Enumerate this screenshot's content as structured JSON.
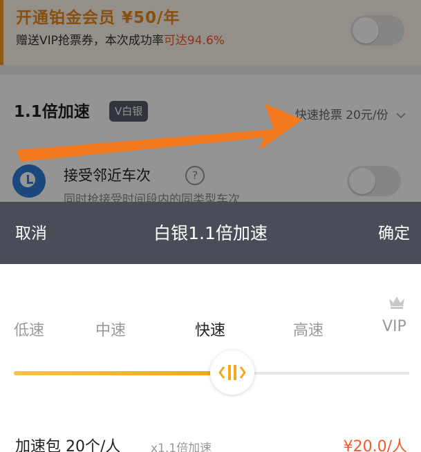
{
  "background": {
    "vip": {
      "title": "开通铂金会员 ¥50/年",
      "subtitle_prefix": "赠送VIP抢票券，本次成功率",
      "subtitle_highlight": "可达94.6%",
      "toggle_on": false
    },
    "speed": {
      "title": "1.1倍加速",
      "badge": "V白银",
      "right_text": "快速抢票 20元/份",
      "chevron": "chevron-down-icon"
    },
    "nearby": {
      "title": "接受邻近车次",
      "help": "?",
      "subtitle": "同时抢接受时间段内的同类型车次",
      "toggle_on": false
    }
  },
  "annotation": {
    "arrow_color": "#f47a20"
  },
  "picker": {
    "cancel_label": "取消",
    "title": "白银1.1倍加速",
    "confirm_label": "确定",
    "levels": [
      "低速",
      "中速",
      "快速",
      "高速",
      "VIP"
    ],
    "selected_level": "快速",
    "crown_icon": "crown-icon",
    "slider_value_fraction": 0.5,
    "colors": {
      "accent": "#f0a81c",
      "header_bg": "#4a4d57",
      "price": "#f25a2a"
    }
  },
  "package": {
    "name": "加速包 20个/人",
    "multiplier": "x1.1倍加速",
    "price": "¥20.0/人"
  }
}
